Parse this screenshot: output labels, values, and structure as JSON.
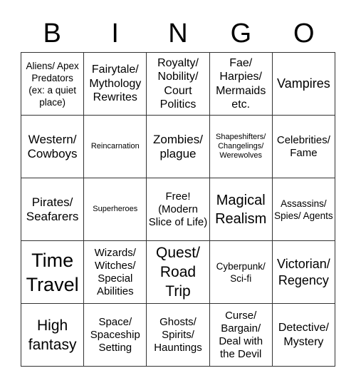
{
  "header": [
    "B",
    "I",
    "N",
    "G",
    "O"
  ],
  "cells": [
    [
      "Aliens/ Apex Predators (ex: a quiet place)",
      "Fairytale/ Mythology Rewrites",
      "Royalty/ Nobility/ Court Politics",
      "Fae/ Harpies/ Mermaids etc.",
      "Vampires"
    ],
    [
      "Western/ Cowboys",
      "Reincarnation",
      "Zombies/ plague",
      "Shapeshifters/ Changelings/ Werewolves",
      "Celebrities/ Fame"
    ],
    [
      "Pirates/ Seafarers",
      "Superheroes",
      "Free! (Modern Slice of Life)",
      "Magical Realism",
      "Assassins/ Spies/ Agents"
    ],
    [
      "Time Travel",
      "Wizards/ Witches/ Special Abilities",
      "Quest/ Road Trip",
      "Cyberpunk/ Sci-fi",
      "Victorian/ Regency"
    ],
    [
      "High fantasy",
      "Space/ Spaceship Setting",
      "Ghosts/ Spirits/ Hauntings",
      "Curse/ Bargain/ Deal with the Devil",
      "Detective/ Mystery"
    ]
  ]
}
